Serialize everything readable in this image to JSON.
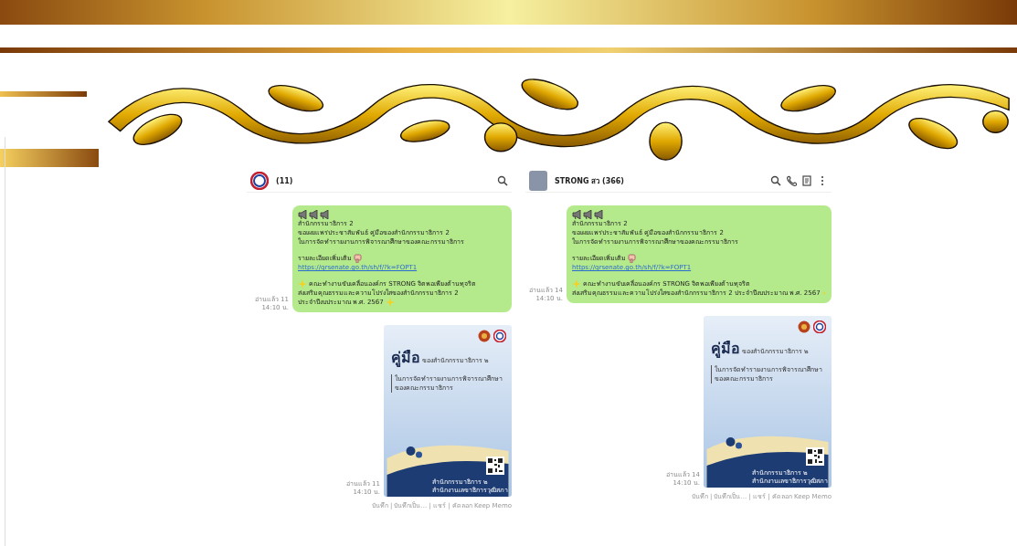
{
  "chats": [
    {
      "title": "(11)",
      "kind": "compact",
      "messages": [
        {
          "kind": "text",
          "read": "อ่านแล้ว 11",
          "time": "14:10 น.",
          "lines": [
            "สำนักกรรมาธิการ 2",
            "ขอเผยแพร่ประชาสัมพันธ์ คู่มือของสำนักกรรมาธิการ 2",
            "ในการจัดทำรายงานการพิจารณาศึกษาของคณะกรรมาธิการ"
          ],
          "more": "รายละเอียดเพิ่มเติม",
          "link": "https://qrsenate.go.th/sh/f/?k=FOPT1",
          "footer": [
            "คณะทำงานขับเคลื่อนองค์กร STRONG จิตพอเพียงต้านทุจริต",
            "ส่งเสริมคุณธรรมและความโปร่งใสของสำนักกรรมาธิการ 2",
            "ประจำปีงบประมาณ พ.ศ. 2567"
          ]
        },
        {
          "kind": "image",
          "read": "อ่านแล้ว 11",
          "time": "14:10 น.",
          "cover": {
            "title": "คู่มือ",
            "subtitle": "ของสำนักกรรมาธิการ ๒",
            "lines": [
              "ในการจัดทำรายงานการพิจารณาศึกษา",
              "ของคณะกรรมาธิการ"
            ],
            "footer": [
              "สำนักกรรมาธิการ ๒",
              "สำนักงานเลขาธิการวุฒิสภา"
            ]
          },
          "actions": "บันทึก | บันทึกเป็น... | แชร์ | คัดลอก Keep Memo"
        }
      ]
    },
    {
      "title": "STRONG สว (366)",
      "kind": "full",
      "messages": [
        {
          "kind": "text",
          "read": "อ่านแล้ว 14",
          "time": "14:10 น.",
          "lines": [
            "สำนักกรรมาธิการ 2",
            "ขอเผยแพร่ประชาสัมพันธ์ คู่มือของสำนักกรรมาธิการ 2",
            "ในการจัดทำรายงานการพิจารณาศึกษาของคณะกรรมาธิการ"
          ],
          "more": "รายละเอียดเพิ่มเติม",
          "link": "https://qrsenate.go.th/sh/f/?k=FOPT1",
          "footer": [
            "คณะทำงานขับเคลื่อนองค์กร STRONG จิตพอเพียงต้านทุจริต",
            "ส่งเสริมคุณธรรมและความโปร่งใสของสำนักกรรมาธิการ 2 ประจำปีงบประมาณ พ.ศ. 2567"
          ]
        },
        {
          "kind": "image",
          "read": "อ่านแล้ว 14",
          "time": "14:10 น.",
          "cover": {
            "title": "คู่มือ",
            "subtitle": "ของสำนักกรรมาธิการ ๒",
            "lines": [
              "ในการจัดทำรายงานการพิจารณาศึกษา",
              "ของคณะกรรมาธิการ"
            ],
            "footer": [
              "สำนักกรรมาธิการ ๒",
              "สำนักงานเลขาธิการวุฒิสภา"
            ]
          },
          "actions": "บันทึก | บันทึกเป็น... | แชร์ | คัดลอก Keep Memo"
        }
      ]
    }
  ]
}
